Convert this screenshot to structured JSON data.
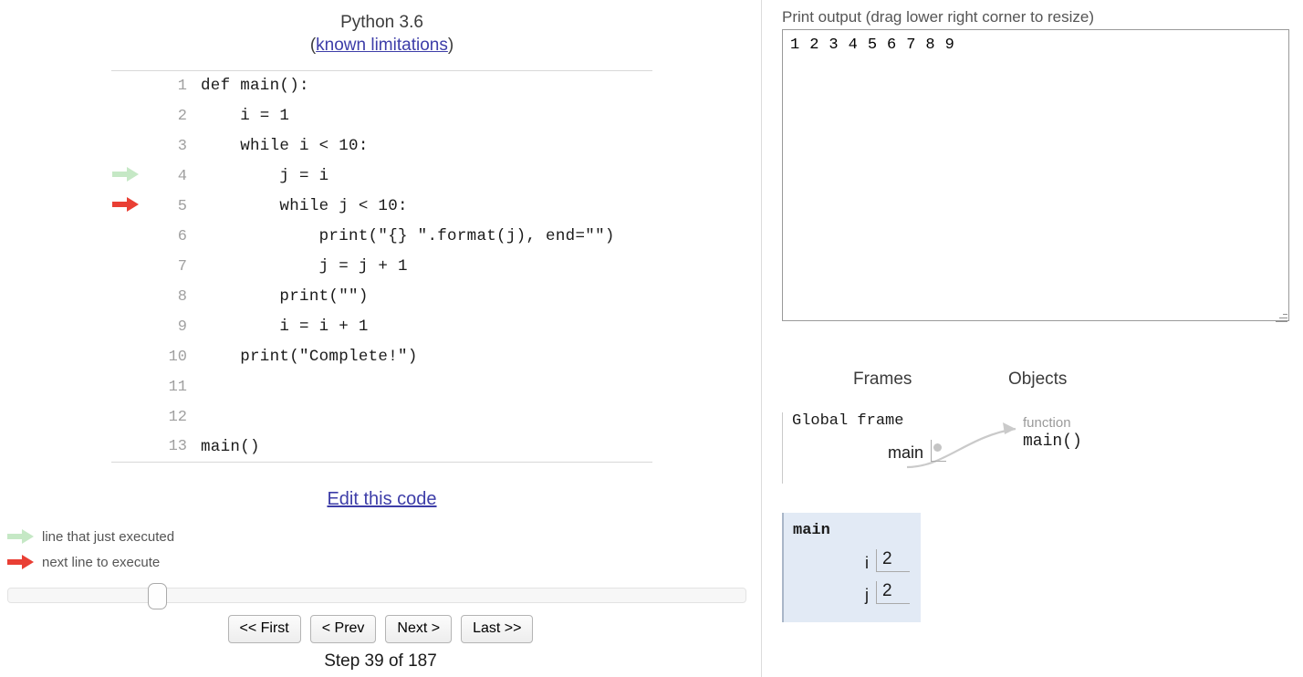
{
  "header": {
    "title": "Python 3.6",
    "paren_open": "(",
    "known_limitations": "known limitations",
    "paren_close": ")"
  },
  "code": {
    "lines": [
      {
        "n": "1",
        "text": "def main():",
        "arrow": "none"
      },
      {
        "n": "2",
        "text": "    i = 1",
        "arrow": "none"
      },
      {
        "n": "3",
        "text": "    while i < 10:",
        "arrow": "none"
      },
      {
        "n": "4",
        "text": "        j = i",
        "arrow": "green"
      },
      {
        "n": "5",
        "text": "        while j < 10:",
        "arrow": "red"
      },
      {
        "n": "6",
        "text": "            print(\"{} \".format(j), end=\"\")",
        "arrow": "none"
      },
      {
        "n": "7",
        "text": "            j = j + 1",
        "arrow": "none"
      },
      {
        "n": "8",
        "text": "        print(\"\")",
        "arrow": "none"
      },
      {
        "n": "9",
        "text": "        i = i + 1",
        "arrow": "none"
      },
      {
        "n": "10",
        "text": "    print(\"Complete!\")",
        "arrow": "none"
      },
      {
        "n": "11",
        "text": "",
        "arrow": "none"
      },
      {
        "n": "12",
        "text": "",
        "arrow": "none"
      },
      {
        "n": "13",
        "text": "main()",
        "arrow": "none"
      }
    ]
  },
  "edit_code_label": "Edit this code",
  "legend": {
    "executed": "line that just executed",
    "next": "next line to execute",
    "executed_color": "#c5e8c5",
    "next_color": "#e93f34"
  },
  "controls": {
    "first": "<< First",
    "prev": "< Prev",
    "next": "Next >",
    "last": "Last >>",
    "step_label": "Step 39 of 187",
    "step_current": 39,
    "step_total": 187
  },
  "print_output": {
    "label": "Print output (drag lower right corner to resize)",
    "value": "1 2 3 4 5 6 7 8 9"
  },
  "visualizer": {
    "frames_heading": "Frames",
    "objects_heading": "Objects",
    "global_frame": {
      "title": "Global frame",
      "vars": [
        {
          "name": "main",
          "value": "",
          "is_pointer": true
        }
      ]
    },
    "frames": [
      {
        "title": "main",
        "vars": [
          {
            "name": "i",
            "value": "2",
            "is_pointer": false
          },
          {
            "name": "j",
            "value": "2",
            "is_pointer": false
          }
        ]
      }
    ],
    "objects": [
      {
        "type": "function",
        "label": "main()"
      }
    ],
    "frame_bg_color": "#e2eaf5"
  }
}
